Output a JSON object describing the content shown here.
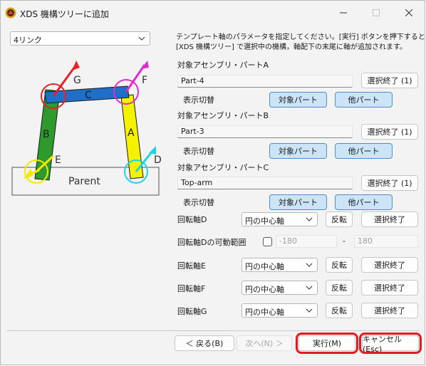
{
  "window": {
    "title": "XDS 機構ツリーに追加"
  },
  "link_select": {
    "value": "4リンク"
  },
  "description": {
    "line1": "テンプレート軸のパラメータを指定してください。[実行] ボタンを押下すると",
    "line2": "[XDS 機構ツリー] で選択中の機構，軸配下の末尾に軸が追加されます。"
  },
  "diagram": {
    "base_label": "Parent",
    "labels": {
      "A": "A",
      "B": "B",
      "C": "C",
      "D": "D",
      "E": "E",
      "F": "F",
      "G": "G"
    }
  },
  "assemblies": [
    {
      "label": "対象アセンブリ・パートA",
      "value": "Part-4",
      "select_done": "選択終了 (1)",
      "toggle_label": "表示切替",
      "target_btn": "対象パート",
      "other_btn": "他パート"
    },
    {
      "label": "対象アセンブリ・パートB",
      "value": "Part-3",
      "select_done": "選択終了 (1)",
      "toggle_label": "表示切替",
      "target_btn": "対象パート",
      "other_btn": "他パート"
    },
    {
      "label": "対象アセンブリ・パートC",
      "value": "Top-arm",
      "select_done": "選択終了 (1)",
      "toggle_label": "表示切替",
      "target_btn": "対象パート",
      "other_btn": "他パート"
    }
  ],
  "axes": {
    "D": {
      "label": "回転軸D",
      "select": "円の中心軸",
      "reverse": "反転",
      "done": "選択終了"
    },
    "range": {
      "label": "回転軸Dの可動範囲",
      "min": "-180",
      "dash": "-",
      "max": "180"
    },
    "E": {
      "label": "回転軸E",
      "select": "円の中心軸",
      "reverse": "反転",
      "done": "選択終了"
    },
    "F": {
      "label": "回転軸F",
      "select": "円の中心軸",
      "reverse": "反転",
      "done": "選択終了"
    },
    "G": {
      "label": "回転軸G",
      "select": "円の中心軸",
      "reverse": "反転",
      "done": "選択終了"
    }
  },
  "footer": {
    "back": "＜ 戻る(B)",
    "next": "次へ(N) ＞",
    "execute": "実行(M)",
    "cancel": "キャンセル(Esc)"
  },
  "colors": {
    "accent": "#cce4f7",
    "highlight": "#e01b24",
    "link_A": "#f5f200",
    "link_B": "#2e9a2e",
    "link_C": "#1f6fc8"
  }
}
